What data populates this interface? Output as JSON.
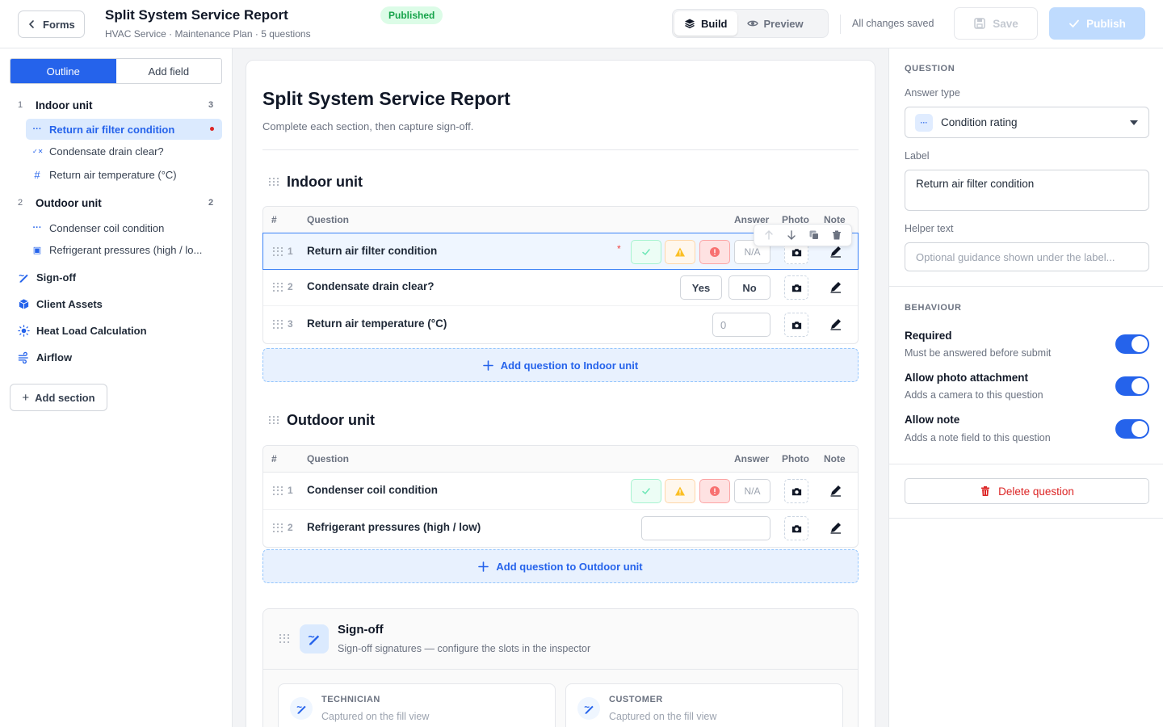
{
  "header": {
    "back_label": "Forms",
    "title": "Split System Service Report",
    "subtitle": "HVAC Service · Maintenance Plan · 5 questions",
    "status_badge": "Published",
    "modes": [
      "Build",
      "Preview"
    ],
    "active_mode": "Build",
    "saved_text": "All changes saved",
    "save_label": "Save",
    "publish_label": "Publish"
  },
  "sidebar": {
    "tabs": [
      "Outline",
      "Add field"
    ],
    "active_tab": "Outline",
    "sections": [
      {
        "num": "1",
        "label": "Indoor unit",
        "count": "3",
        "questions": [
          {
            "icon": "rating-icon",
            "glyph": "···",
            "label": "Return air filter condition",
            "selected": true
          },
          {
            "icon": "yes-no-icon",
            "glyph": "✓✕",
            "label": "Condensate drain clear?"
          },
          {
            "icon": "number-icon",
            "glyph": "#",
            "label": "Return air temperature (°C)"
          }
        ]
      },
      {
        "num": "2",
        "label": "Outdoor unit",
        "count": "2",
        "questions": [
          {
            "icon": "rating-icon",
            "glyph": "···",
            "label": "Condenser coil condition"
          },
          {
            "icon": "text-icon",
            "glyph": "▣",
            "label": "Refrigerant pressures (high / lo..."
          }
        ]
      }
    ],
    "other_items": [
      "Sign-off",
      "Client Assets",
      "Heat Load Calculation",
      "Airflow"
    ],
    "add_section_label": "Add section"
  },
  "canvas": {
    "title": "Split System Service Report",
    "description": "Complete each section, then capture sign-off.",
    "table_headers": {
      "num": "#",
      "question": "Question",
      "answer": "Answer",
      "photo": "Photo",
      "note": "Note"
    },
    "indoor": {
      "title": "Indoor unit",
      "rows": [
        {
          "num": "1",
          "text": "Return air filter condition",
          "answer_type": "rating",
          "na": "N/A",
          "required": "*"
        },
        {
          "num": "2",
          "text": "Condensate drain clear?",
          "answer_type": "yes-no",
          "yes": "Yes",
          "no": "No"
        },
        {
          "num": "3",
          "text": "Return air temperature (°C)",
          "answer_type": "number",
          "placeholder": "0"
        }
      ],
      "add_label": "Add question to Indoor unit"
    },
    "outdoor": {
      "title": "Outdoor unit",
      "rows": [
        {
          "num": "1",
          "text": "Condenser coil condition",
          "answer_type": "rating",
          "na": "N/A"
        },
        {
          "num": "2",
          "text": "Refrigerant pressures (high / low)",
          "answer_type": "text"
        }
      ],
      "add_label": "Add question to Outdoor unit"
    },
    "signoff": {
      "title": "Sign-off",
      "description": "Sign-off signatures — configure the slots in the inspector",
      "slots": [
        {
          "role": "TECHNICIAN",
          "sub": "Captured on the fill view"
        },
        {
          "role": "CUSTOMER",
          "sub": "Captured on the fill view"
        }
      ]
    }
  },
  "inspector": {
    "question_group": "QUESTION",
    "answer_type_label": "Answer type",
    "answer_type_value": "Condition rating",
    "label_label": "Label",
    "label_value": "Return air filter condition",
    "helper_label": "Helper text",
    "helper_placeholder": "Optional guidance shown under the label...",
    "behaviour_group": "BEHAVIOUR",
    "toggles": [
      {
        "title": "Required",
        "sub": "Must be answered before submit",
        "on": true
      },
      {
        "title": "Allow photo attachment",
        "sub": "Adds a camera to this question",
        "on": true
      },
      {
        "title": "Allow note",
        "sub": "Adds a note field to this question",
        "on": true
      }
    ],
    "delete_label": "Delete question"
  },
  "colors": {
    "accent": "#2563eb",
    "danger": "#dc2626",
    "success": "#16a34a"
  }
}
